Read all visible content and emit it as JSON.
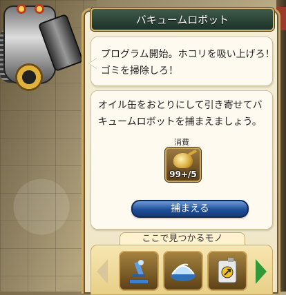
{
  "panel": {
    "title": "バキュームロボット"
  },
  "speech": {
    "line1": "プログラム開始。ホコリを吸い上げろ！",
    "line2": "ゴミを掃除しろ！"
  },
  "info": {
    "line1": "オイル缶をおとりにして引き寄せてバ",
    "line2": "キュームロボットを捕まえましょう。",
    "consume_label": "消費",
    "item_count": "99+/5",
    "item_icon": "oil-can-icon"
  },
  "capture_button": {
    "label": "捕まえる"
  },
  "found": {
    "label": "ここで見つかるモノ",
    "items": [
      {
        "icon": "microscope-icon"
      },
      {
        "icon": "glass-dome-icon"
      },
      {
        "icon": "fuel-canister-icon"
      }
    ]
  }
}
